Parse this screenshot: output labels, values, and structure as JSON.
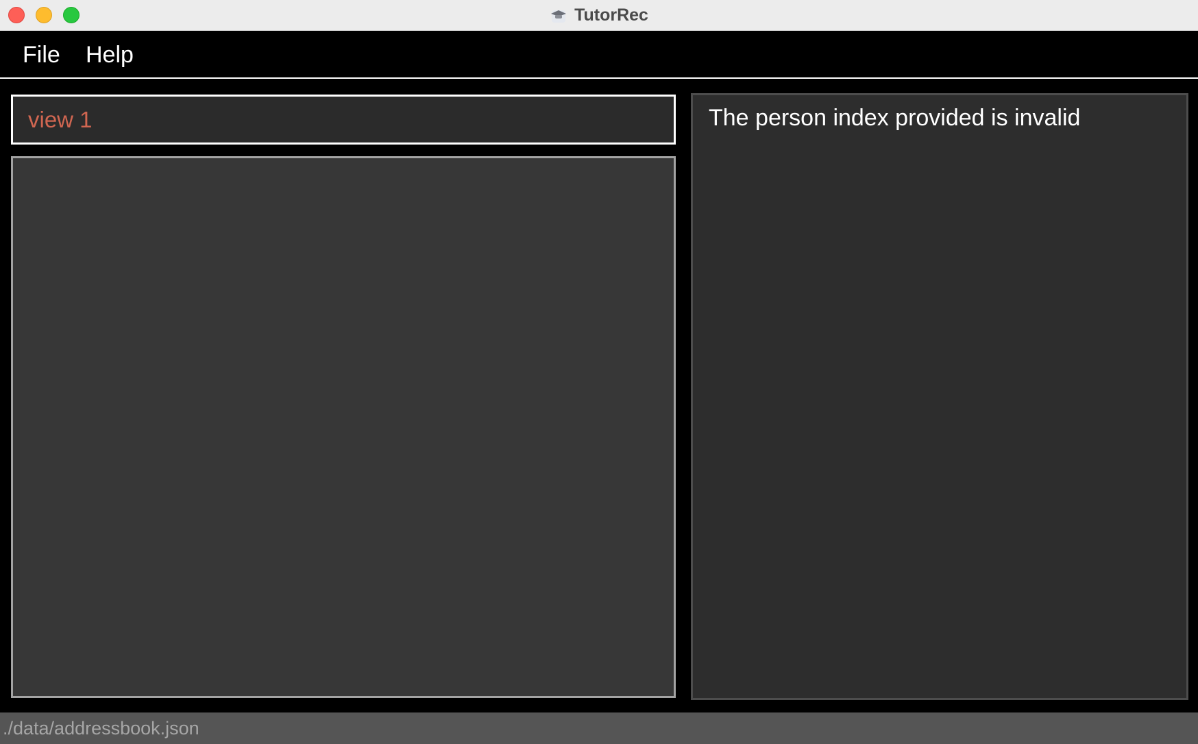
{
  "window": {
    "title": "TutorRec",
    "app_icon": "graduation-cap-icon"
  },
  "menu": {
    "items": [
      {
        "label": "File"
      },
      {
        "label": "Help"
      }
    ]
  },
  "command_box": {
    "value": "view 1",
    "text_color": "#d06651"
  },
  "person_list": {
    "items": []
  },
  "result_display": {
    "message": "The person index provided is invalid"
  },
  "status_bar": {
    "save_location": "./data/addressbook.json"
  },
  "colors": {
    "background": "#000000",
    "panel": "#2d2d2d",
    "list_panel": "#373737",
    "error_text": "#d06651",
    "status_bar": "#555555"
  }
}
